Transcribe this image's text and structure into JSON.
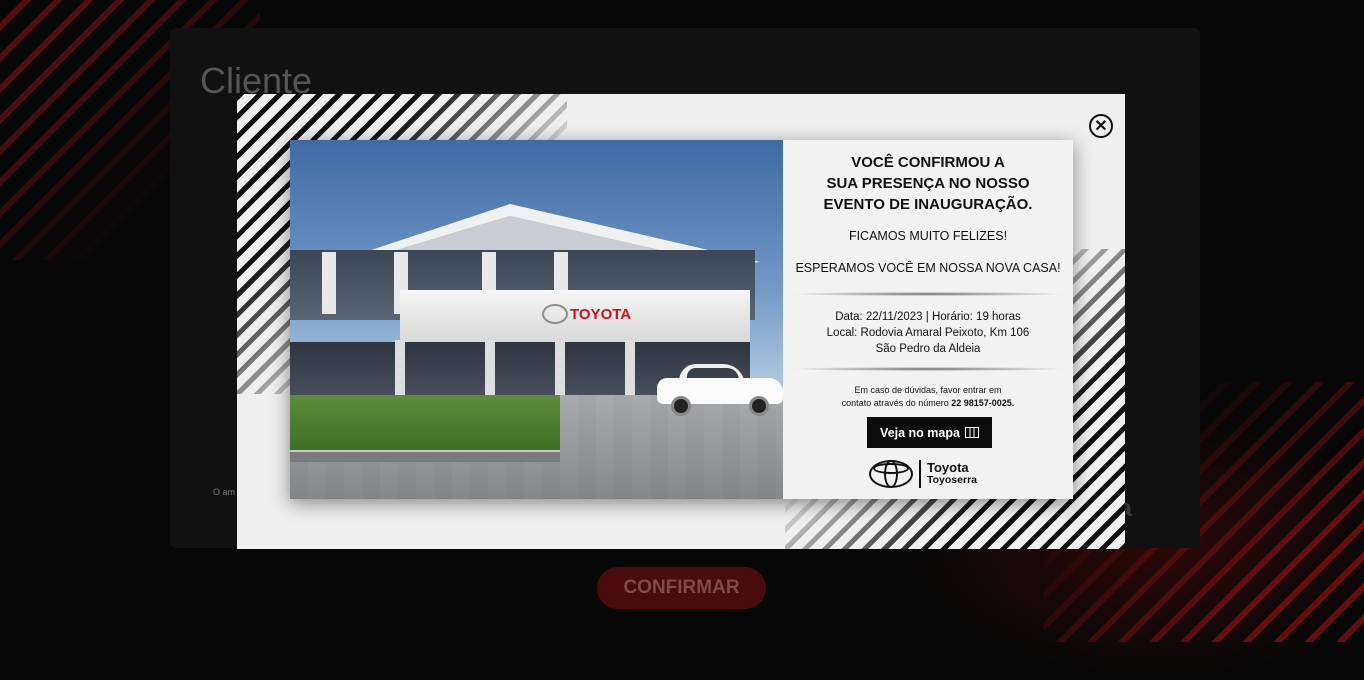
{
  "background": {
    "title": "Cliente",
    "footnote": "O am",
    "brand_fragment": "a\nrra",
    "confirm_label": "CONFIRMAR"
  },
  "modal": {
    "close_icon": "close-circle-icon",
    "building_sign": "TOYOTA",
    "headline_1": "VOCÊ CONFIRMOU A",
    "headline_2": "SUA PRESENÇA NO NOSSO",
    "headline_3": "EVENTO DE INAUGURAÇÃO.",
    "sub_1": "FICAMOS MUITO FELIZES!",
    "sub_2": "ESPERAMOS VOCÊ EM NOSSA NOVA CASA!",
    "event_line_1": "Data: 22/11/2023 | Horário: 19 horas",
    "event_line_2": "Local: Rodovia Amaral Peixoto, Km 106",
    "event_line_3": "São Pedro da Aldeia",
    "contact_line_1": "Em caso de dúvidas, favor entrar em",
    "contact_line_2_prefix": "contato através do número ",
    "contact_phone": "22 98157-0025.",
    "map_button": "Veja no mapa",
    "map_icon": "map-icon",
    "brand_name": "Toyota",
    "brand_dealer": "Toyoserra"
  },
  "colors": {
    "accent_red": "#c4161c",
    "button_black": "#0c0c0c",
    "confirm_bg": "#4a0b0d"
  }
}
